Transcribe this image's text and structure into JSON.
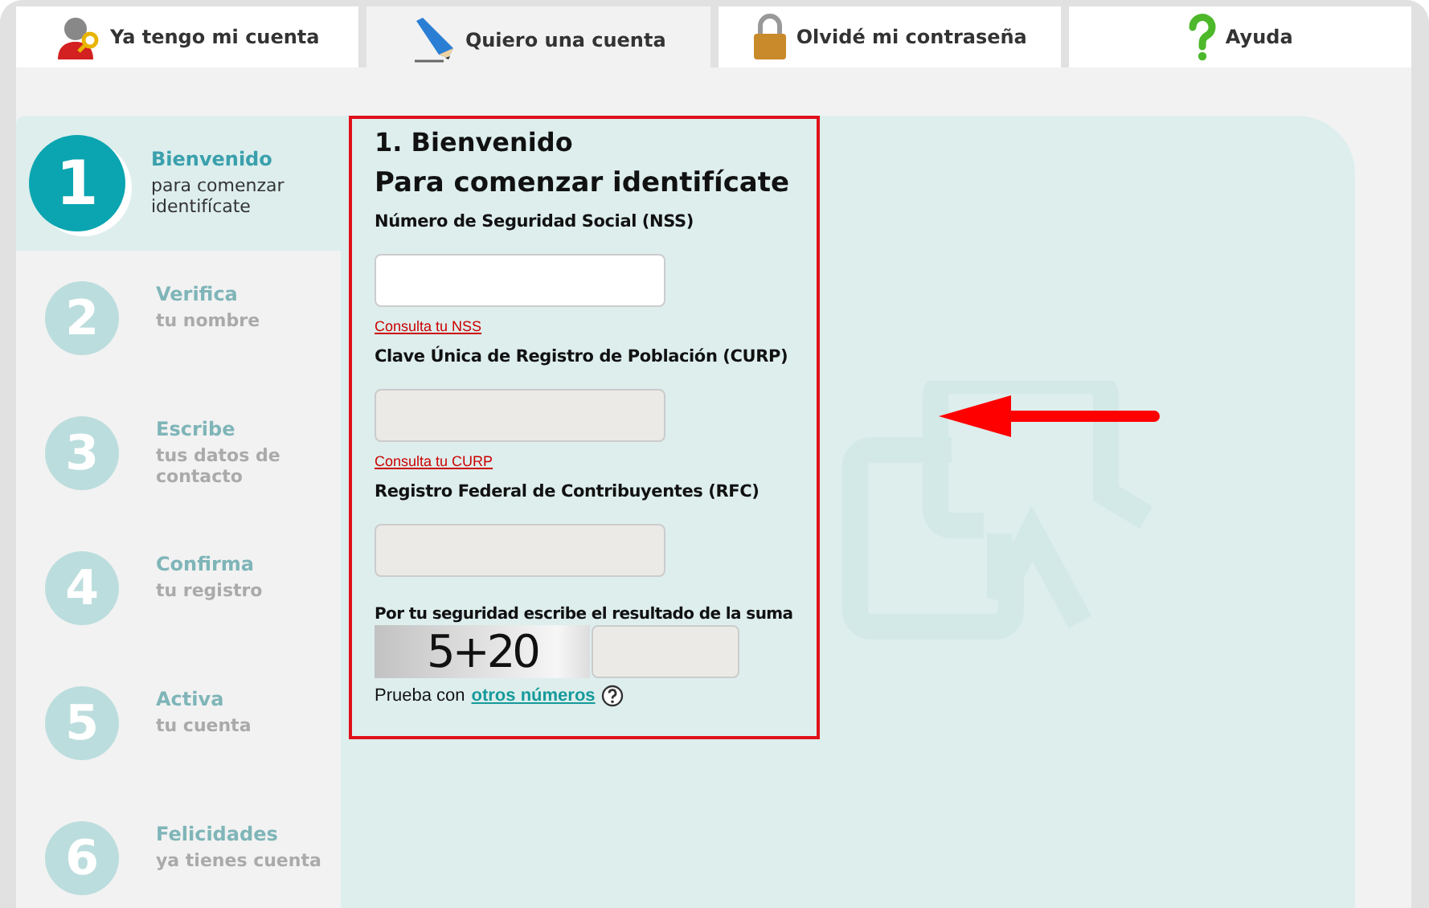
{
  "tabs": [
    {
      "label": "Ya tengo mi cuenta",
      "selected": false
    },
    {
      "label": "Quiero una cuenta",
      "selected": true
    },
    {
      "label": "Olvidé mi contraseña",
      "selected": false
    },
    {
      "label": "Ayuda",
      "selected": false
    }
  ],
  "steps": [
    {
      "number": "1",
      "title": "Bienvenido",
      "subtitle": "para comenzar identifícate",
      "selected": true
    },
    {
      "number": "2",
      "title": "Verifica",
      "subtitle": "tu nombre",
      "selected": false
    },
    {
      "number": "3",
      "title": "Escribe",
      "subtitle": "tus datos de contacto",
      "selected": false
    },
    {
      "number": "4",
      "title": "Confirma",
      "subtitle": "tu registro",
      "selected": false
    },
    {
      "number": "5",
      "title": "Activa",
      "subtitle": "tu cuenta",
      "selected": false
    },
    {
      "number": "6",
      "title": "Felicidades",
      "subtitle": "ya tienes cuenta",
      "selected": false
    }
  ],
  "form": {
    "heading": "1. Bienvenido",
    "subheading": "Para comenzar identifícate",
    "fields": [
      {
        "label": "Número de Seguridad Social (NSS)",
        "disabled": false,
        "link": "Consulta tu NSS"
      },
      {
        "label": "Clave Única de Registro de Población (CURP)",
        "disabled": true,
        "link": "Consulta tu CURP"
      },
      {
        "label": "Registro Federal de Contribuyentes (RFC)",
        "disabled": true
      }
    ],
    "captcha": {
      "label": "Por tu seguridad escribe el resultado de la suma",
      "challenge": "5+20",
      "hint": "Prueba con",
      "link": "otros números"
    }
  }
}
